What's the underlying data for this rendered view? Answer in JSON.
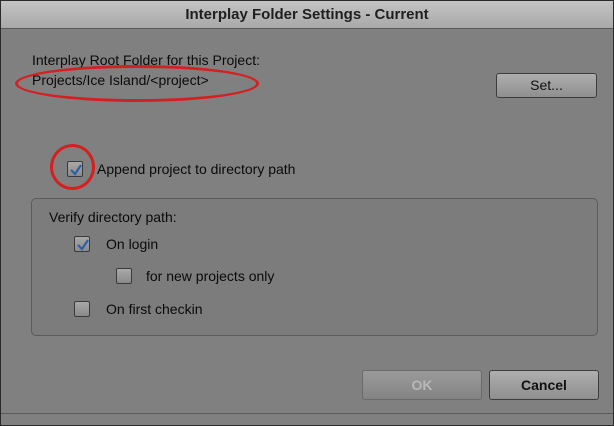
{
  "dialog": {
    "title": "Interplay Folder Settings - Current",
    "root_folder_label": "Interplay Root Folder for this Project:",
    "root_folder_path": "Projects/Ice Island/<project>",
    "set_button": "Set...",
    "append_checkbox": {
      "label": "Append project to directory path",
      "checked": true
    },
    "verify_group": {
      "label": "Verify directory path:",
      "options": [
        {
          "label": "On login",
          "checked": true
        },
        {
          "label": "for new projects only",
          "checked": false
        },
        {
          "label": "On first checkin",
          "checked": false
        }
      ]
    },
    "ok_button": "OK",
    "cancel_button": "Cancel"
  },
  "colors": {
    "dialog_bg": "#808080",
    "annotation_ring": "#d42020",
    "check_mark": "#2b5fa8"
  }
}
